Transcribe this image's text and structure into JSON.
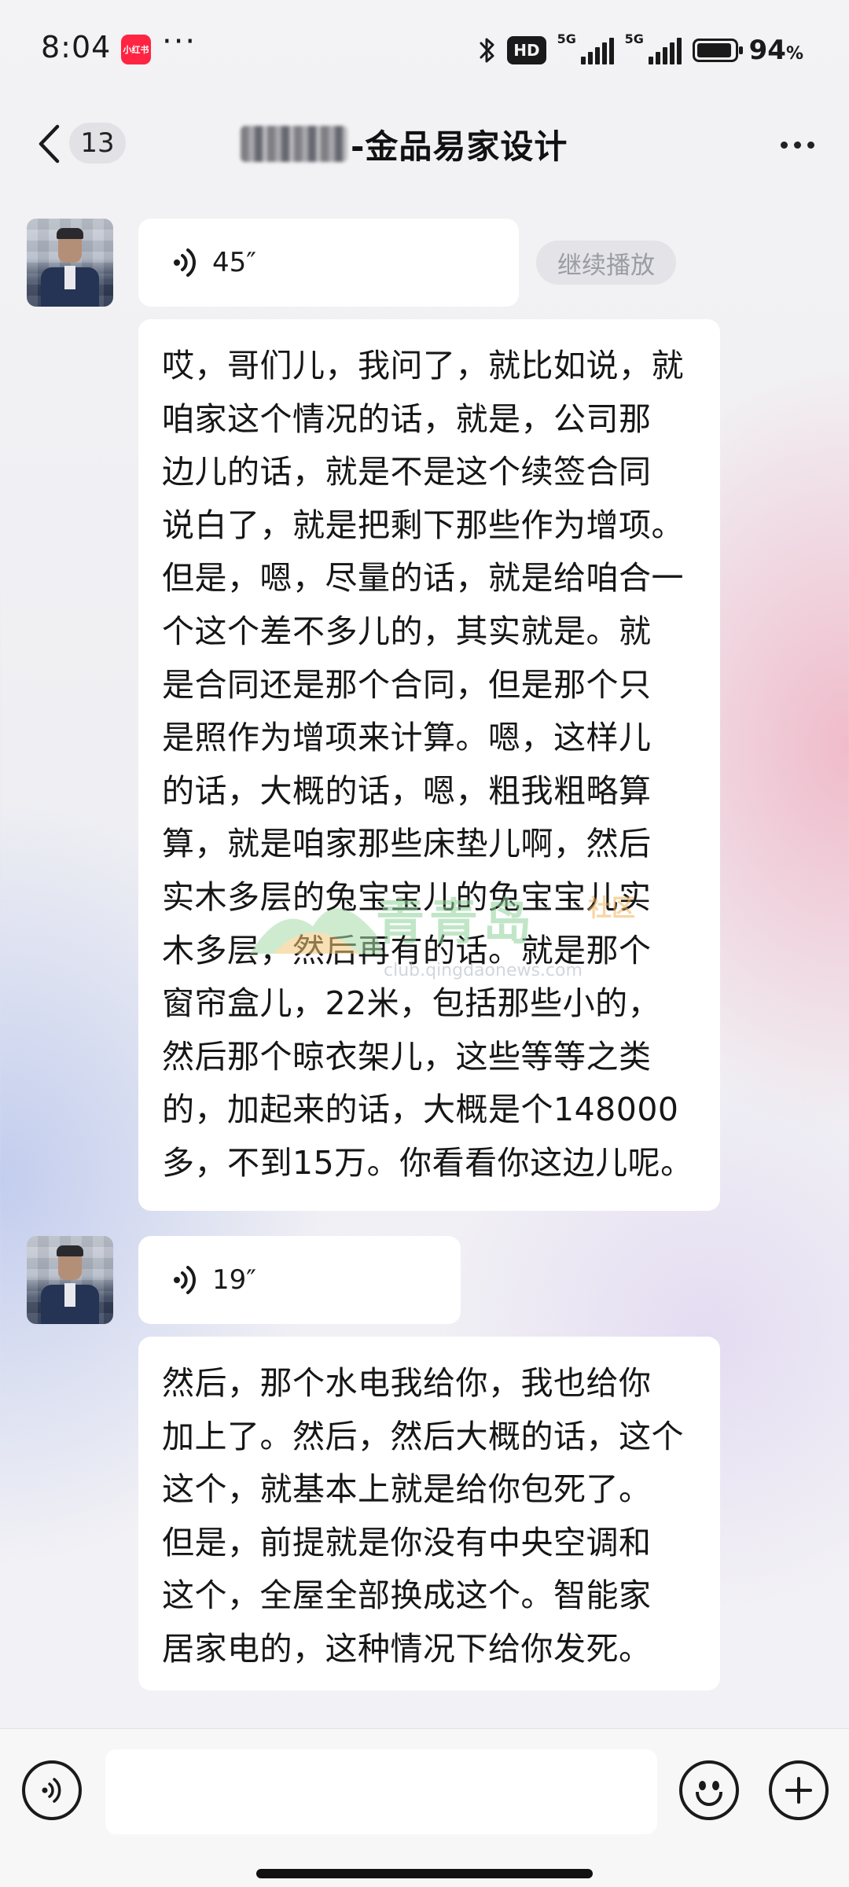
{
  "status_bar": {
    "time": "8:04",
    "app_badge": "小红书",
    "more": "···",
    "hd": "HD",
    "network_1": "5G",
    "network_2": "5G",
    "battery_level": 0.94,
    "battery_text": "94",
    "battery_unit": "%"
  },
  "header": {
    "unread_count": "13",
    "title": "-金品易家设计"
  },
  "messages": [
    {
      "type": "voice",
      "duration": "45″",
      "continue_label": "继续播放"
    },
    {
      "type": "text",
      "text": "哎，哥们儿，我问了，就比如说，就\n咱家这个情况的话，就是，公司那\n边儿的话，就是不是这个续签合同\n说白了，就是把剩下那些作为增项。\n但是，嗯，尽量的话，就是给咱合一\n个这个差不多儿的，其实就是。就\n是合同还是那个合同，但是那个只\n是照作为增项来计算。嗯，这样儿\n的话，大概的话，嗯，粗我粗略算\n算，就是咱家那些床垫儿啊，然后\n实木多层的兔宝宝儿的兔宝宝儿实\n木多层，然后再有的话。就是那个\n窗帘盒儿，22米，包括那些小的，\n然后那个晾衣架儿，这些等等之类\n的，加起来的话，大概是个148000\n多，不到15万。你看看你这边儿呢。"
    },
    {
      "type": "voice",
      "duration": "19″"
    },
    {
      "type": "text",
      "text": "然后，那个水电我给你，我也给你\n加上了。然后，然后大概的话，这个\n这个，就基本上就是给你包死了。\n但是，前提就是你没有中央空调和\n这个，全屋全部换成这个。智能家\n居家电的，这种情况下给你发死。"
    }
  ],
  "watermark": {
    "brand": "青青岛",
    "tag": "社区",
    "url": "club.qingdaonews.com"
  },
  "input": {
    "value": "",
    "placeholder": ""
  },
  "icons": {
    "back": "chevron-left-icon",
    "more": "more-horizontal-icon",
    "voice_wave": "voice-wave-icon",
    "voice_input": "voice-input-icon",
    "emoji": "emoji-icon",
    "plus": "plus-icon"
  }
}
